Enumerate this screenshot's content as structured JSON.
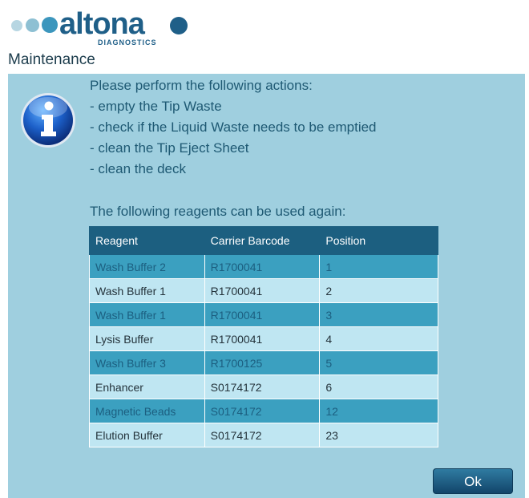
{
  "app": {
    "logo_text": "altona",
    "logo_subtext": "DIAGNOSTICS",
    "window_title": "Maintenance"
  },
  "message": {
    "heading": "Please perform the following actions:",
    "actions": [
      "- empty the Tip Waste",
      "- check if the Liquid Waste needs to be emptied",
      "- clean the Tip Eject Sheet",
      "- clean the deck"
    ]
  },
  "reagents": {
    "label": "The following reagents can be used again:",
    "columns": [
      "Reagent",
      "Carrier Barcode",
      "Position"
    ],
    "rows": [
      [
        "Wash Buffer 2",
        "R1700041",
        "1"
      ],
      [
        "Wash Buffer 1",
        "R1700041",
        "2"
      ],
      [
        "Wash Buffer 1",
        "R1700041",
        "3"
      ],
      [
        "Lysis Buffer",
        "R1700041",
        "4"
      ],
      [
        "Wash Buffer 3",
        "R1700125",
        "5"
      ],
      [
        "Enhancer",
        "S0174172",
        "6"
      ],
      [
        "Magnetic Beads",
        "S0174172",
        "12"
      ],
      [
        "Elution Buffer",
        "S0174172",
        "23"
      ]
    ]
  },
  "buttons": {
    "ok_label": "Ok"
  },
  "icons": {
    "info": "info-icon"
  },
  "colors": {
    "brand": "#1f5f88",
    "accent_light": "#8fc3d4",
    "content_bg": "#9fcfdf",
    "table_header": "#1c5f80",
    "row_dark": "#3ba0c0",
    "row_light": "#bfe6f2"
  }
}
